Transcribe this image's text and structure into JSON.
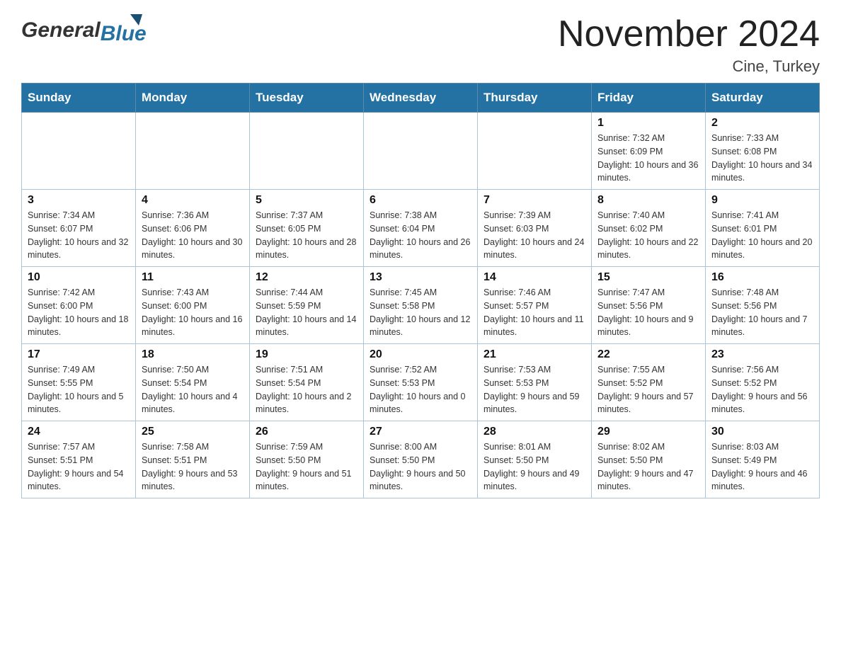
{
  "header": {
    "title": "November 2024",
    "location": "Cine, Turkey"
  },
  "logo": {
    "general": "General",
    "blue": "Blue"
  },
  "days_of_week": [
    "Sunday",
    "Monday",
    "Tuesday",
    "Wednesday",
    "Thursday",
    "Friday",
    "Saturday"
  ],
  "weeks": [
    [
      {
        "day": "",
        "info": ""
      },
      {
        "day": "",
        "info": ""
      },
      {
        "day": "",
        "info": ""
      },
      {
        "day": "",
        "info": ""
      },
      {
        "day": "",
        "info": ""
      },
      {
        "day": "1",
        "info": "Sunrise: 7:32 AM\nSunset: 6:09 PM\nDaylight: 10 hours and 36 minutes."
      },
      {
        "day": "2",
        "info": "Sunrise: 7:33 AM\nSunset: 6:08 PM\nDaylight: 10 hours and 34 minutes."
      }
    ],
    [
      {
        "day": "3",
        "info": "Sunrise: 7:34 AM\nSunset: 6:07 PM\nDaylight: 10 hours and 32 minutes."
      },
      {
        "day": "4",
        "info": "Sunrise: 7:36 AM\nSunset: 6:06 PM\nDaylight: 10 hours and 30 minutes."
      },
      {
        "day": "5",
        "info": "Sunrise: 7:37 AM\nSunset: 6:05 PM\nDaylight: 10 hours and 28 minutes."
      },
      {
        "day": "6",
        "info": "Sunrise: 7:38 AM\nSunset: 6:04 PM\nDaylight: 10 hours and 26 minutes."
      },
      {
        "day": "7",
        "info": "Sunrise: 7:39 AM\nSunset: 6:03 PM\nDaylight: 10 hours and 24 minutes."
      },
      {
        "day": "8",
        "info": "Sunrise: 7:40 AM\nSunset: 6:02 PM\nDaylight: 10 hours and 22 minutes."
      },
      {
        "day": "9",
        "info": "Sunrise: 7:41 AM\nSunset: 6:01 PM\nDaylight: 10 hours and 20 minutes."
      }
    ],
    [
      {
        "day": "10",
        "info": "Sunrise: 7:42 AM\nSunset: 6:00 PM\nDaylight: 10 hours and 18 minutes."
      },
      {
        "day": "11",
        "info": "Sunrise: 7:43 AM\nSunset: 6:00 PM\nDaylight: 10 hours and 16 minutes."
      },
      {
        "day": "12",
        "info": "Sunrise: 7:44 AM\nSunset: 5:59 PM\nDaylight: 10 hours and 14 minutes."
      },
      {
        "day": "13",
        "info": "Sunrise: 7:45 AM\nSunset: 5:58 PM\nDaylight: 10 hours and 12 minutes."
      },
      {
        "day": "14",
        "info": "Sunrise: 7:46 AM\nSunset: 5:57 PM\nDaylight: 10 hours and 11 minutes."
      },
      {
        "day": "15",
        "info": "Sunrise: 7:47 AM\nSunset: 5:56 PM\nDaylight: 10 hours and 9 minutes."
      },
      {
        "day": "16",
        "info": "Sunrise: 7:48 AM\nSunset: 5:56 PM\nDaylight: 10 hours and 7 minutes."
      }
    ],
    [
      {
        "day": "17",
        "info": "Sunrise: 7:49 AM\nSunset: 5:55 PM\nDaylight: 10 hours and 5 minutes."
      },
      {
        "day": "18",
        "info": "Sunrise: 7:50 AM\nSunset: 5:54 PM\nDaylight: 10 hours and 4 minutes."
      },
      {
        "day": "19",
        "info": "Sunrise: 7:51 AM\nSunset: 5:54 PM\nDaylight: 10 hours and 2 minutes."
      },
      {
        "day": "20",
        "info": "Sunrise: 7:52 AM\nSunset: 5:53 PM\nDaylight: 10 hours and 0 minutes."
      },
      {
        "day": "21",
        "info": "Sunrise: 7:53 AM\nSunset: 5:53 PM\nDaylight: 9 hours and 59 minutes."
      },
      {
        "day": "22",
        "info": "Sunrise: 7:55 AM\nSunset: 5:52 PM\nDaylight: 9 hours and 57 minutes."
      },
      {
        "day": "23",
        "info": "Sunrise: 7:56 AM\nSunset: 5:52 PM\nDaylight: 9 hours and 56 minutes."
      }
    ],
    [
      {
        "day": "24",
        "info": "Sunrise: 7:57 AM\nSunset: 5:51 PM\nDaylight: 9 hours and 54 minutes."
      },
      {
        "day": "25",
        "info": "Sunrise: 7:58 AM\nSunset: 5:51 PM\nDaylight: 9 hours and 53 minutes."
      },
      {
        "day": "26",
        "info": "Sunrise: 7:59 AM\nSunset: 5:50 PM\nDaylight: 9 hours and 51 minutes."
      },
      {
        "day": "27",
        "info": "Sunrise: 8:00 AM\nSunset: 5:50 PM\nDaylight: 9 hours and 50 minutes."
      },
      {
        "day": "28",
        "info": "Sunrise: 8:01 AM\nSunset: 5:50 PM\nDaylight: 9 hours and 49 minutes."
      },
      {
        "day": "29",
        "info": "Sunrise: 8:02 AM\nSunset: 5:50 PM\nDaylight: 9 hours and 47 minutes."
      },
      {
        "day": "30",
        "info": "Sunrise: 8:03 AM\nSunset: 5:49 PM\nDaylight: 9 hours and 46 minutes."
      }
    ]
  ]
}
